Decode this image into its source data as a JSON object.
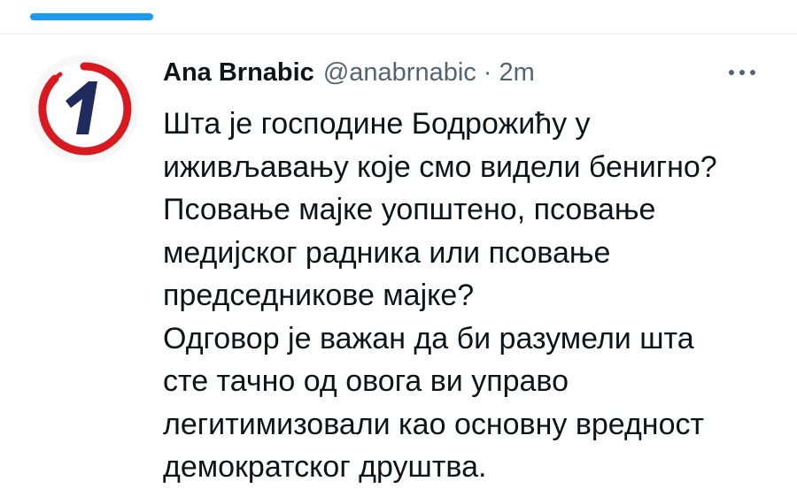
{
  "tweet": {
    "author_name": "Ana Brnabic",
    "handle": "@anabrnabic",
    "separator": "·",
    "time": "2m",
    "avatar_icon": "tv-channel-one-logo-icon",
    "more_icon": "more-options-icon",
    "lines": [
      "Шта је господине Бодрожићу у",
      "иживљавању које смо видели бенигно?",
      "Псовање мајке уопштено, псовање",
      "медијског радника или псовање",
      "председникове мајке?",
      "Одговор је важан да би разумели шта",
      "сте тачно од овога ви управо",
      "легитимизовали као основну вредност",
      "демократског друштва."
    ]
  },
  "colors": {
    "accent": "#1d9bf0",
    "text": "#0f1419",
    "secondary": "#536471",
    "logo_red": "#d71920",
    "logo_navy": "#1f2b5c"
  }
}
